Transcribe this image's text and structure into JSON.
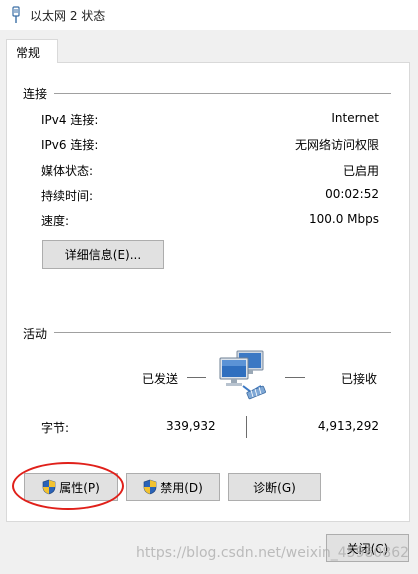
{
  "window": {
    "title": "以太网 2 状态"
  },
  "tabs": [
    {
      "label": "常规"
    }
  ],
  "connection": {
    "group_label": "连接",
    "rows": [
      {
        "label": "IPv4 连接:",
        "value": "Internet"
      },
      {
        "label": "IPv6 连接:",
        "value": "无网络访问权限"
      },
      {
        "label": "媒体状态:",
        "value": "已启用"
      },
      {
        "label": "持续时间:",
        "value": "00:02:52"
      },
      {
        "label": "速度:",
        "value": "100.0 Mbps"
      }
    ],
    "details_button": "详细信息(E)..."
  },
  "activity": {
    "group_label": "活动",
    "sent_label": "已发送",
    "received_label": "已接收",
    "bytes_label": "字节:",
    "bytes_sent": "339,932",
    "bytes_received": "4,913,292",
    "network_icon": "network-computers-icon"
  },
  "buttons": {
    "properties": "属性(P)",
    "disable": "禁用(D)",
    "diagnose": "诊断(G)",
    "close": "关闭(C)"
  },
  "annotation": {
    "highlight_color": "#e0201a"
  },
  "watermark": "https://blog.csdn.net/weixin_45980862"
}
